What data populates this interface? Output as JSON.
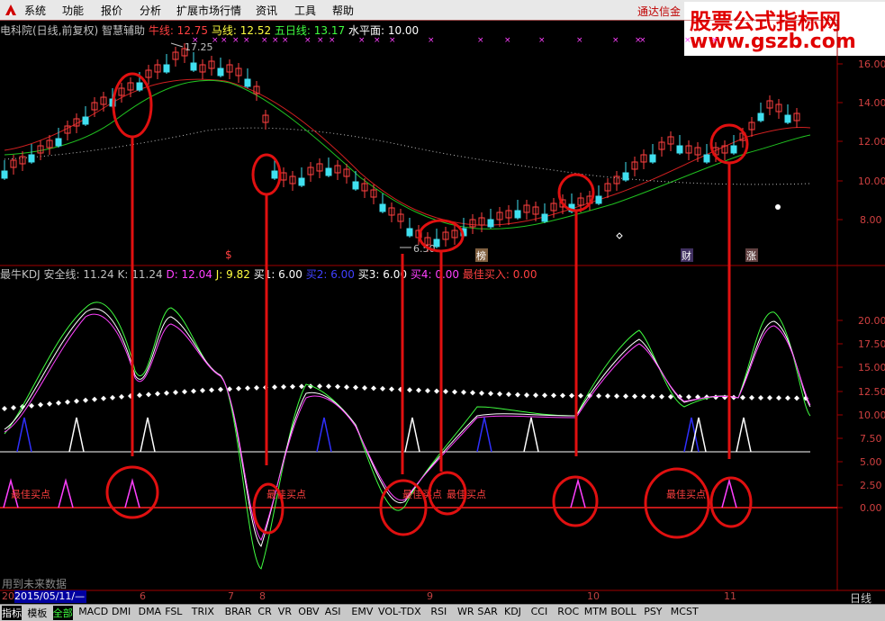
{
  "menubar": {
    "items": [
      "系统",
      "功能",
      "报价",
      "分析",
      "扩展市场行情",
      "资讯",
      "工具",
      "帮助"
    ],
    "broker": "通达信金"
  },
  "watermark": {
    "line1": "股票公式指标网",
    "line2": "www.gszb.com"
  },
  "price_panel": {
    "header": [
      {
        "text": "电科院(日线,前复权) 智慧辅助",
        "color": "#c0c0c0"
      },
      {
        "text": "牛线: 12.75",
        "color": "#ff4040"
      },
      {
        "text": "马线: 12.52",
        "color": "#ffff40"
      },
      {
        "text": "五日线: 13.17",
        "color": "#40ff40"
      },
      {
        "text": "水平面: 10.00",
        "color": "#ffffff"
      }
    ],
    "y_ticks": [
      "16.00",
      "14.00",
      "12.00",
      "10.00",
      "8.00"
    ],
    "annotations": {
      "high": "17.25",
      "low": "6.50",
      "markers": [
        "$",
        "榜",
        "财",
        "涨"
      ]
    }
  },
  "kdj_panel": {
    "header": [
      {
        "text": "最牛KDJ",
        "color": "#c0c0c0"
      },
      {
        "text": "安全线: 11.24",
        "color": "#c0c0c0"
      },
      {
        "text": "K: 11.24",
        "color": "#c0c0c0"
      },
      {
        "text": "D: 12.04",
        "color": "#ff40ff"
      },
      {
        "text": "J: 9.82",
        "color": "#ffff40"
      },
      {
        "text": "买1: 6.00",
        "color": "#ffffff"
      },
      {
        "text": "买2: 6.00",
        "color": "#4040ff"
      },
      {
        "text": "买3: 6.00",
        "color": "#ffffff"
      },
      {
        "text": "买4: 0.00",
        "color": "#ff40ff"
      },
      {
        "text": "最佳买入: 0.00",
        "color": "#ff4040"
      }
    ],
    "y_ticks": [
      "20.00",
      "17.50",
      "15.00",
      "12.50",
      "10.00",
      "7.50",
      "5.00",
      "2.50",
      "0.00"
    ],
    "label_best_buy": "最佳买点"
  },
  "x_axis": {
    "start_date": "2015/05/11/—",
    "months": [
      "6",
      "7",
      "8",
      "9",
      "10",
      "11"
    ],
    "left_label": "20"
  },
  "footer": {
    "future_data": "用到未来数据",
    "period": "日线",
    "tabs": [
      "指标",
      "模板",
      "全部",
      "MACD",
      "DMI",
      "DMA",
      "FSL",
      "TRIX",
      "BRAR",
      "CR",
      "VR",
      "OBV",
      "ASI",
      "EMV",
      "VOL-TDX",
      "RSI",
      "WR",
      "SAR",
      "KDJ",
      "CCI",
      "ROC",
      "MTM",
      "BOLL",
      "PSY",
      "MCST"
    ]
  }
}
